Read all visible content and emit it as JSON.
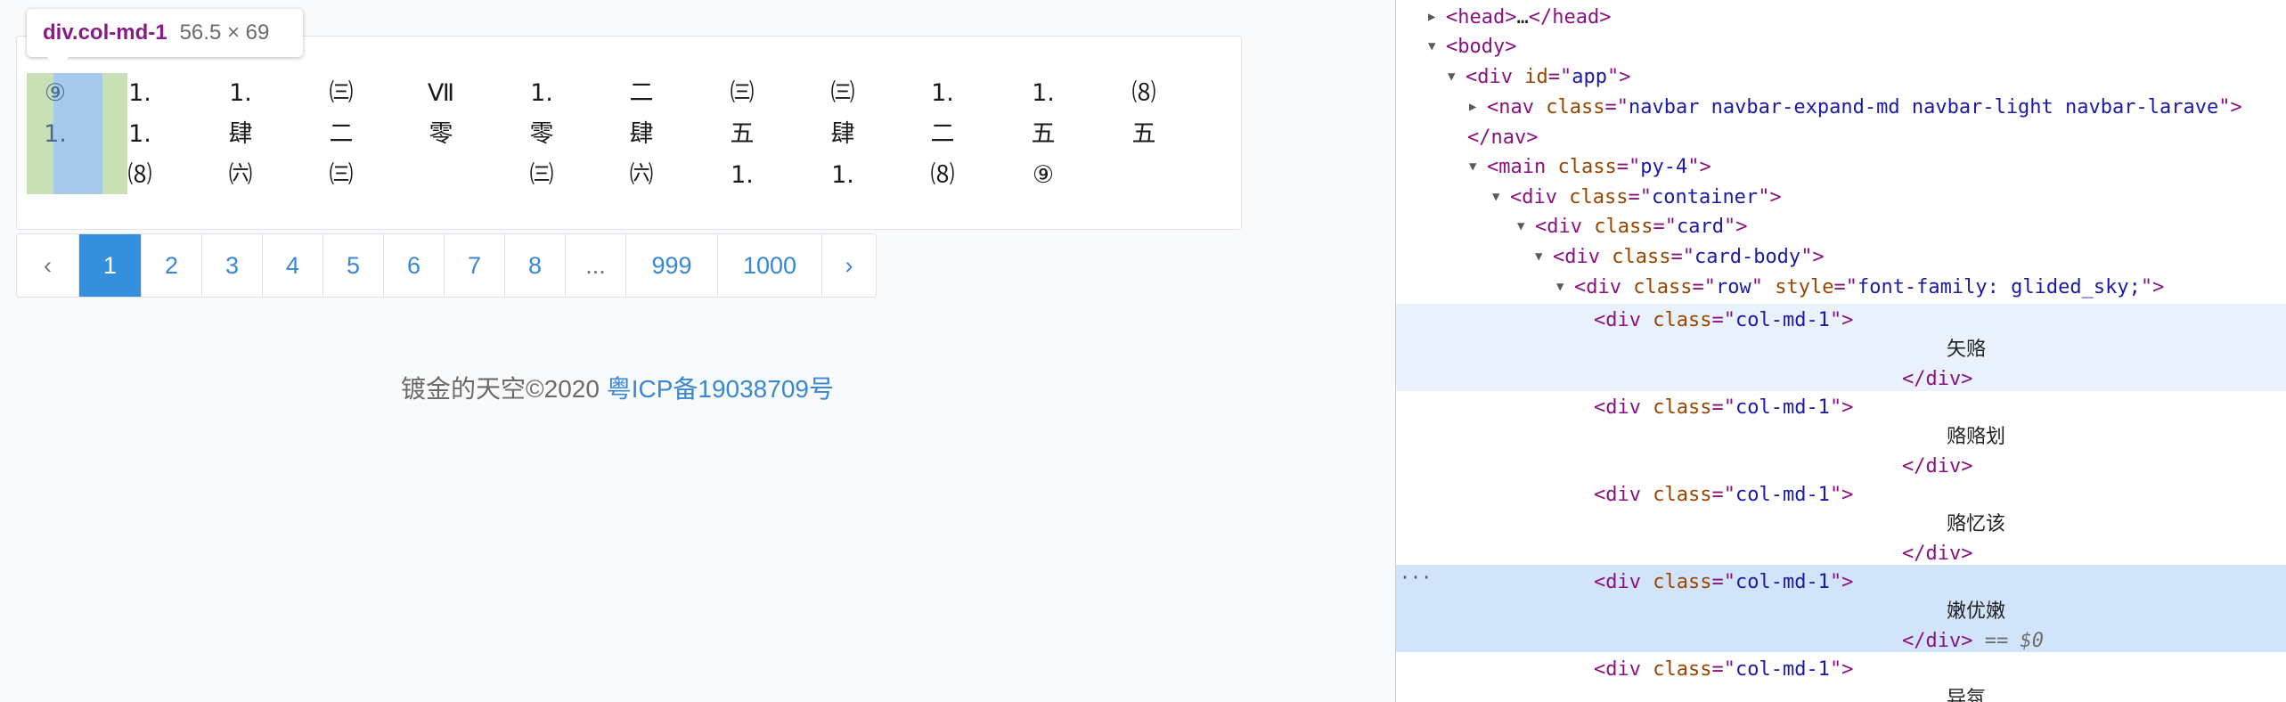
{
  "tooltip": {
    "selector": "div.col-md-1",
    "dims": "56.5 × 69"
  },
  "card_columns": [
    [
      "⑨",
      "1."
    ],
    [
      "1.",
      "1.",
      "⑻"
    ],
    [
      "1.",
      "肆",
      "㈥"
    ],
    [
      "㈢",
      "二",
      "㈢"
    ],
    [
      "Ⅶ",
      "零",
      ""
    ],
    [
      "1.",
      "零",
      "㈢"
    ],
    [
      "二",
      "肆",
      "㈥"
    ],
    [
      "㈢",
      "五",
      "1."
    ],
    [
      "㈢",
      "肆",
      "1."
    ],
    [
      "1.",
      "二",
      "⑻"
    ],
    [
      "1.",
      "五",
      "⑨"
    ],
    [
      "⑻",
      "五",
      ""
    ]
  ],
  "pagination": {
    "prev": "‹",
    "pages": [
      "1",
      "2",
      "3",
      "4",
      "5",
      "6",
      "7",
      "8"
    ],
    "active": "1",
    "ellipsis": "...",
    "tail": [
      "999",
      "1000"
    ],
    "next": "›"
  },
  "footer": {
    "text": "镀金的天空©2020 ",
    "icp": "粤ICP备19038709号"
  },
  "devtools": {
    "head": {
      "open": "<head>",
      "ellipsis": "…",
      "close": "</head>"
    },
    "body": "<body>",
    "app": {
      "tag": "div",
      "attr": "id",
      "value": "app"
    },
    "nav": {
      "tag": "nav",
      "attr": "class",
      "value": "navbar navbar-expand-md navbar-light navbar-larave"
    },
    "nav_close": "</nav>",
    "main": {
      "tag": "main",
      "attr": "class",
      "value": "py-4"
    },
    "container": {
      "tag": "div",
      "attr": "class",
      "value": "container"
    },
    "card": {
      "tag": "div",
      "attr": "class",
      "value": "card"
    },
    "card_body": {
      "tag": "div",
      "attr": "class",
      "value": "card-body"
    },
    "row": {
      "tag": "div",
      "attr1": "class",
      "value1": "row",
      "attr2": "style",
      "value2": "font-family: glided_sky;"
    },
    "col_attr": "class",
    "col_value": "col-md-1",
    "col_close": "</div>",
    "col_texts": [
      "矢赂",
      "赂赂划",
      "赂忆该",
      "嫩优嫩",
      "异氛"
    ],
    "selected_marker": "== $0",
    "gutter_dots": "···"
  },
  "colors": {
    "accent": "#3490dc",
    "tag": "#881280",
    "attr": "#994500",
    "value": "#1a1aa6"
  }
}
